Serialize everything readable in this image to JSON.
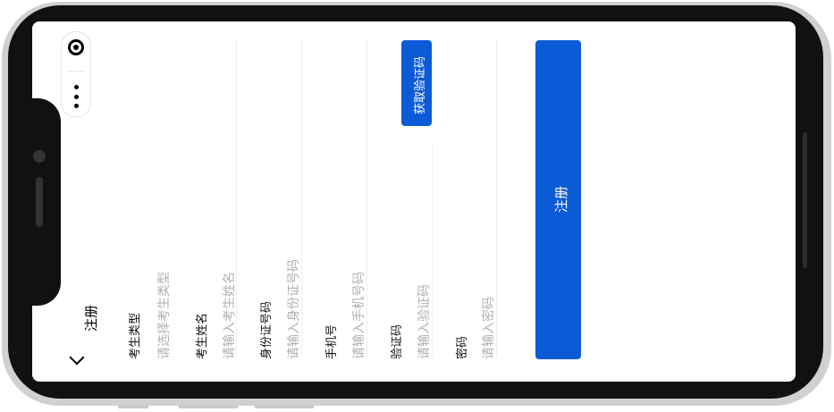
{
  "nav": {
    "back_icon": "chevron-left-icon",
    "title": "注册"
  },
  "capsule": {
    "target_icon": "target-icon",
    "more_icon": "more-dots-icon"
  },
  "form": {
    "fields": [
      {
        "label": "考生类型",
        "placeholder": "请选择考生类型"
      },
      {
        "label": "考生姓名",
        "placeholder": "请输入考生姓名"
      },
      {
        "label": "身份证号码",
        "placeholder": "请输入身份证号码"
      },
      {
        "label": "手机号",
        "placeholder": "请输入手机号码"
      },
      {
        "label": "验证码",
        "placeholder": "请输入验证码"
      },
      {
        "label": "密码",
        "placeholder": "请输入密码"
      }
    ],
    "get_code_label": "获取验证码",
    "submit_label": "注册"
  },
  "colors": {
    "primary": "#0c5bd6",
    "placeholder": "#b0b0b0",
    "frame": "#111111"
  }
}
